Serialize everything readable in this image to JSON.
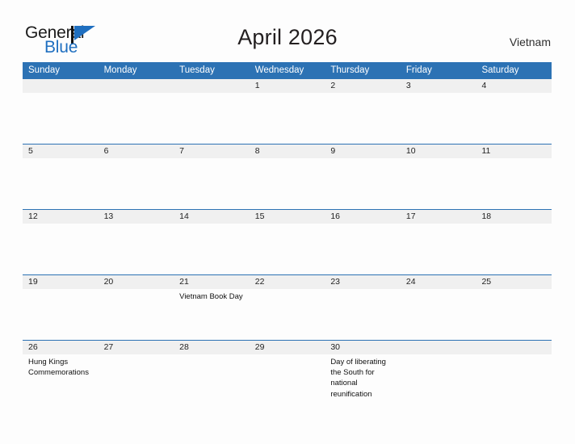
{
  "brand": {
    "word1": "General",
    "word2": "Blue",
    "accent_color": "#1f6fc0",
    "dark_color": "#1b1b1b"
  },
  "header": {
    "title": "April 2026",
    "country": "Vietnam"
  },
  "calendar": {
    "header_bg_color": "#2c72b4",
    "date_strip_color": "#f0f0f0",
    "weekdays": [
      "Sunday",
      "Monday",
      "Tuesday",
      "Wednesday",
      "Thursday",
      "Friday",
      "Saturday"
    ],
    "weeks": [
      {
        "dates": [
          "",
          "",
          "",
          "1",
          "2",
          "3",
          "4"
        ],
        "events": [
          "",
          "",
          "",
          "",
          "",
          "",
          ""
        ]
      },
      {
        "dates": [
          "5",
          "6",
          "7",
          "8",
          "9",
          "10",
          "11"
        ],
        "events": [
          "",
          "",
          "",
          "",
          "",
          "",
          ""
        ]
      },
      {
        "dates": [
          "12",
          "13",
          "14",
          "15",
          "16",
          "17",
          "18"
        ],
        "events": [
          "",
          "",
          "",
          "",
          "",
          "",
          ""
        ]
      },
      {
        "dates": [
          "19",
          "20",
          "21",
          "22",
          "23",
          "24",
          "25"
        ],
        "events": [
          "",
          "",
          "Vietnam Book Day",
          "",
          "",
          "",
          ""
        ]
      },
      {
        "dates": [
          "26",
          "27",
          "28",
          "29",
          "30",
          "",
          ""
        ],
        "events": [
          "Hung Kings Commemorations",
          "",
          "",
          "",
          "Day of liberating the South for national reunification",
          "",
          ""
        ]
      }
    ]
  }
}
